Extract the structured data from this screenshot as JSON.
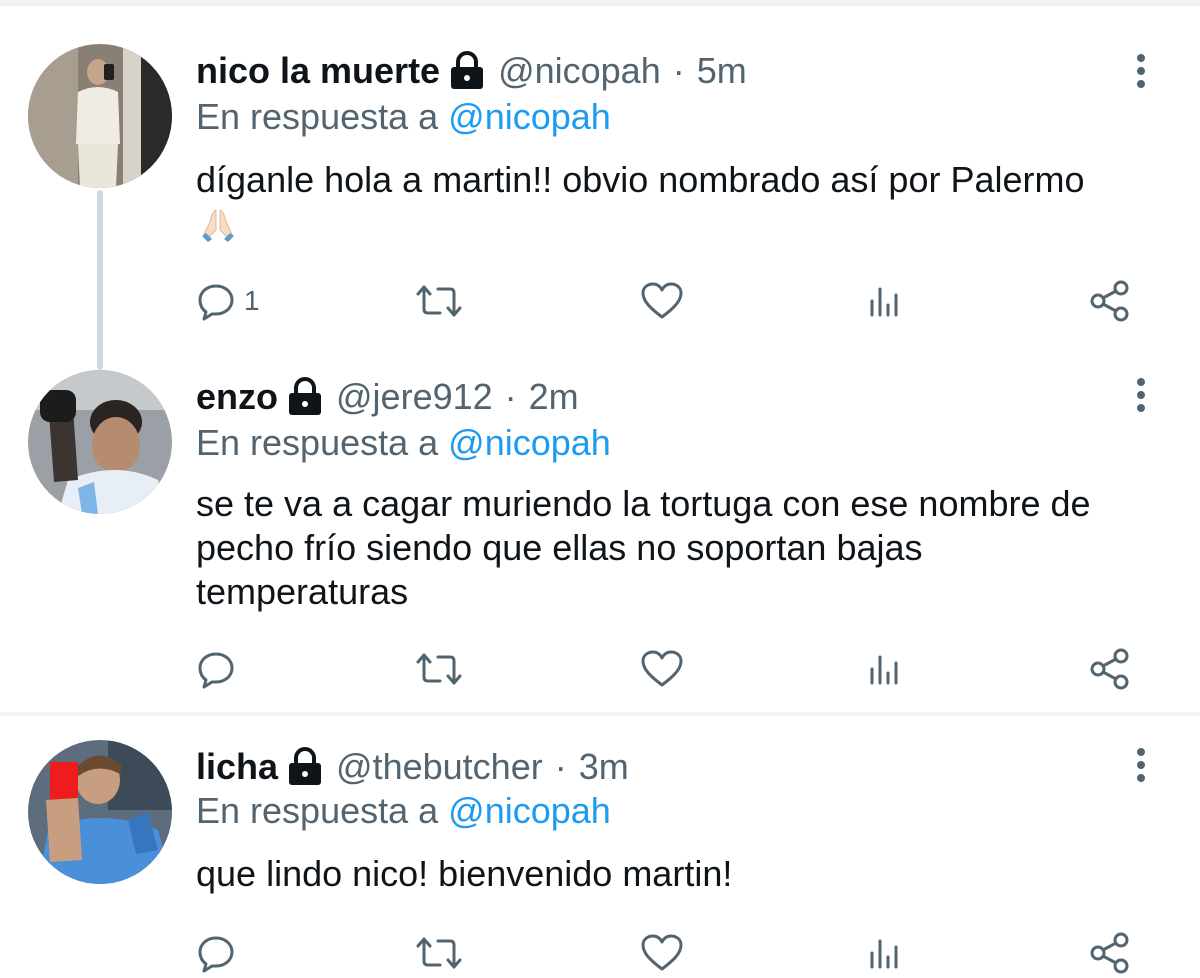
{
  "tweets": [
    {
      "name": "nico la muerte",
      "handle": "@nicopah",
      "time": "5m",
      "reply_prefix": "En respuesta a",
      "reply_mention": "@nicopah",
      "text": "díganle hola a martin!! obvio nombrado así por Palermo",
      "emoji": "folded-hands-emoji",
      "reply_count": "1"
    },
    {
      "name": "enzo",
      "handle": "@jere912",
      "time": "2m",
      "reply_prefix": "En respuesta a",
      "reply_mention": "@nicopah",
      "text_lines": [
        "se te va a cagar muriendo la tortuga con ese nombre de",
        "pecho frío siendo que ellas no soportan bajas",
        "temperaturas"
      ],
      "reply_count": ""
    },
    {
      "name": "licha",
      "handle": "@thebutcher",
      "time": "3m",
      "reply_prefix": "En respuesta a",
      "reply_mention": "@nicopah",
      "text": "que lindo nico! bienvenido martin!",
      "reply_count": ""
    }
  ],
  "separator_dot": "·",
  "colors": {
    "text": "#0f1419",
    "secondary": "#536471",
    "link": "#1d9bf0",
    "divider": "#eff3f4",
    "thread_line": "#cfd9de"
  },
  "icons": [
    "lock-icon",
    "more-icon",
    "reply-icon",
    "retweet-icon",
    "like-icon",
    "views-icon",
    "share-icon"
  ]
}
